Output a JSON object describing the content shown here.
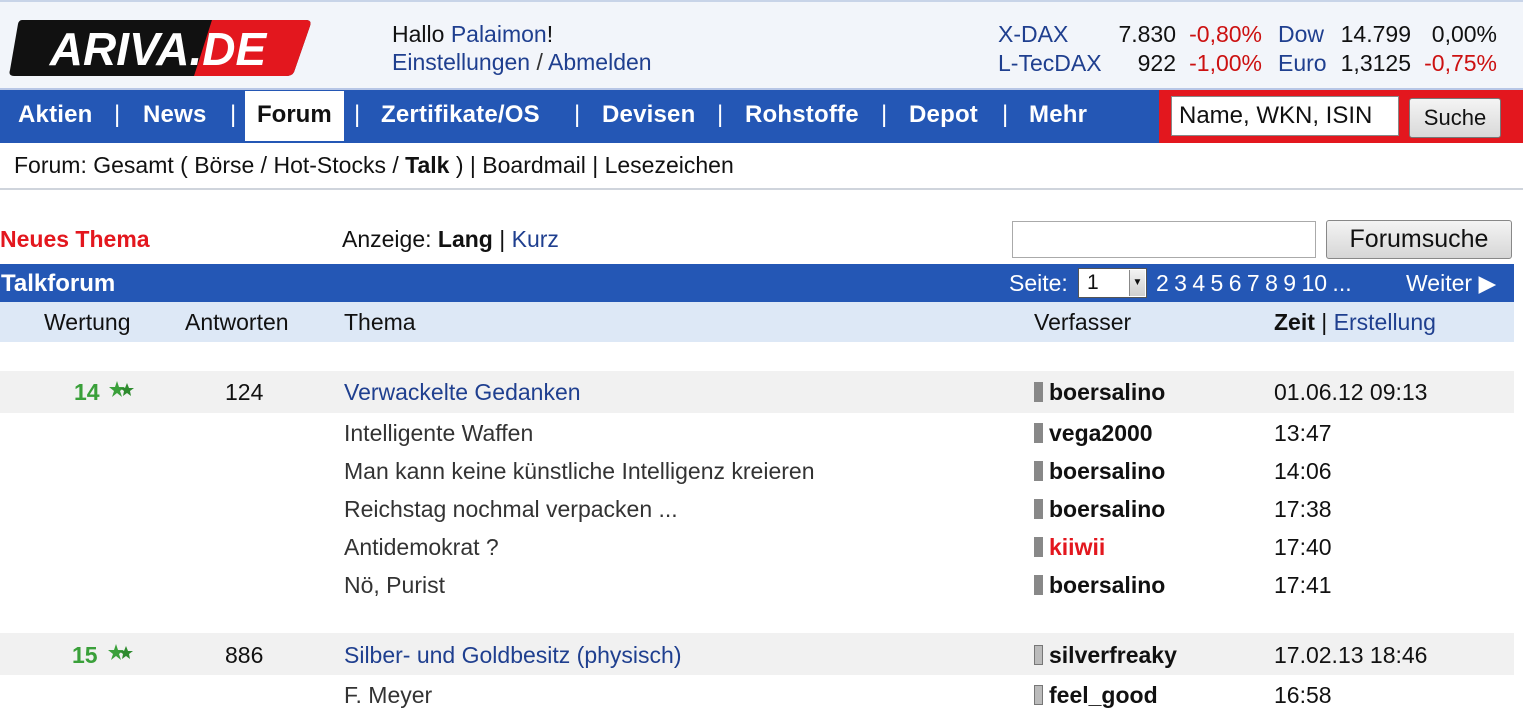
{
  "header": {
    "logo_text": "ARIVA.DE",
    "greeting_prefix": "Hallo ",
    "username": "Palaimon",
    "greeting_suffix": "!",
    "settings_link": "Einstellungen",
    "link_separator": " / ",
    "logout_link": "Abmelden",
    "quotes": [
      {
        "name": "X-DAX",
        "value": "7.830",
        "change": "-0,80%"
      },
      {
        "name": "L-TecDAX",
        "value": "922",
        "change": "-1,00%"
      },
      {
        "name": "Dow",
        "value": "14.799",
        "change": "0,00%"
      },
      {
        "name": "Euro",
        "value": "1,3125",
        "change": "-0,75%"
      }
    ]
  },
  "nav": {
    "items": [
      "Aktien",
      "News",
      "Forum",
      "Zertifikate/OS",
      "Devisen",
      "Rohstoffe",
      "Depot",
      "Mehr"
    ],
    "active": "Forum",
    "search_value": "Name, WKN, ISIN",
    "search_button": "Suche"
  },
  "subnav": {
    "prefix": "Forum: Gesamt ( ",
    "boerse": "Börse",
    "hot": "Hot-Stocks",
    "talk": "Talk",
    "close": " )",
    "boardmail": "Boardmail",
    "bookmarks": "Lesezeichen"
  },
  "toolbar": {
    "new_thread": "Neues Thema",
    "display_label": "Anzeige: ",
    "display_long": "Lang",
    "display_short": "Kurz",
    "forum_search_button": "Forumsuche"
  },
  "forum": {
    "title": "Talkforum",
    "page_label": "Seite:",
    "page_selected": "1",
    "page_numbers": "2 3 4 5 6 7 8 9 10 ...",
    "next": "Weiter"
  },
  "columns": {
    "rating": "Wertung",
    "replies": "Antworten",
    "topic": "Thema",
    "author": "Verfasser",
    "time": "Zeit",
    "created": "Erstellung"
  },
  "threads": [
    {
      "score": "14",
      "replies": "124",
      "title": "Verwackelte Gedanken",
      "author": "boersalino",
      "time": "01.06.12 09:13",
      "posts": [
        {
          "title": "Intelligente Waffen",
          "author": "vega2000",
          "time": "13:47"
        },
        {
          "title": "Man kann keine künstliche Intelligenz kreieren",
          "author": "boersalino",
          "time": "14:06"
        },
        {
          "title": "Reichstag nochmal verpacken ...",
          "author": "boersalino",
          "time": "17:38"
        },
        {
          "title": "Antidemokrat ?",
          "author": "kiiwii",
          "time": "17:40"
        },
        {
          "title": "Nö, Purist",
          "author": "boersalino",
          "time": "17:41"
        }
      ]
    },
    {
      "score": "15",
      "replies": "886",
      "title": "Silber- und Goldbesitz (physisch)",
      "author": "silverfreaky",
      "time": "17.02.13 18:46",
      "posts": [
        {
          "title": "F. Meyer",
          "author": "feel_good",
          "time": "16:58"
        }
      ]
    }
  ],
  "colors": {
    "nav_blue": "#2457b5",
    "brand_red": "#e3171e",
    "link_blue": "#1f3f8f",
    "score_green": "#3aa03a"
  }
}
